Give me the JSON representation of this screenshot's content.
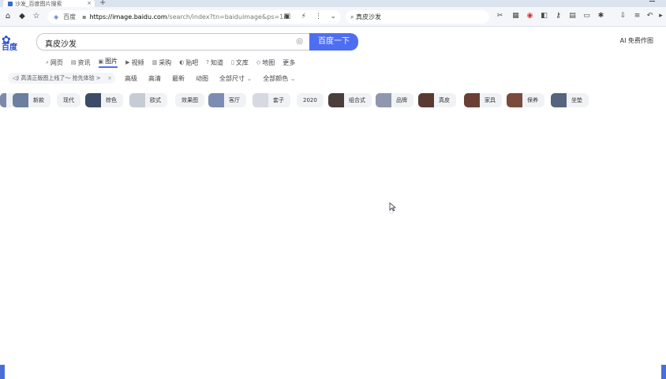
{
  "browser": {
    "tab_title": "沙发_百度图片搜索",
    "new_tab": "+",
    "close_tab": "×",
    "url_site": "百度",
    "url_host": "https://image.baidu.com",
    "url_rest": "/search/index?tn=baiduimage&ps=1&",
    "top_search": "真皮沙发"
  },
  "header": {
    "logo_text": "百度",
    "query": "真皮沙发",
    "search_button": "百度一下",
    "ai_button": "AI 免费作图"
  },
  "nav": {
    "items": [
      "网页",
      "资讯",
      "图片",
      "视频",
      "采购",
      "贴吧",
      "知道",
      "文库",
      "地图",
      "更多"
    ],
    "active": "图片"
  },
  "promo": {
    "text": "高清正版图上线了～ 抢先体验 >"
  },
  "filters": [
    "高级",
    "高清",
    "最新",
    "动图",
    "全部尺寸",
    "全部颜色"
  ],
  "tags": [
    "新款",
    "现代",
    "棕色",
    "欧式",
    "效果图",
    "客厅",
    "套子",
    "2020",
    "组合式",
    "品牌",
    "真皮",
    "家具",
    "保养",
    "坐垫"
  ],
  "colors": {
    "accent": "#4e6ef2",
    "brand": "#2b4fcb"
  }
}
